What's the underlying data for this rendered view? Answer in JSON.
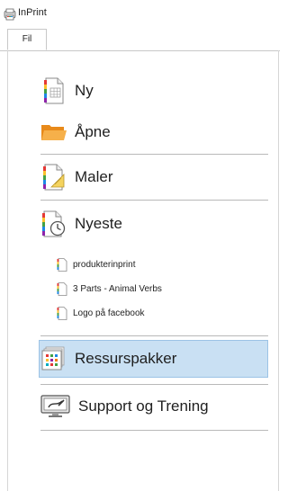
{
  "app": {
    "title": "InPrint"
  },
  "tabs": {
    "file_label": "Fil"
  },
  "menu": {
    "new_label": "Ny",
    "open_label": "Åpne",
    "templates_label": "Maler",
    "recent_label": "Nyeste",
    "resources_label": "Ressurspakker",
    "support_label": "Support og Trening"
  },
  "recent": [
    {
      "label": "produkterinprint"
    },
    {
      "label": "3 Parts - Animal Verbs"
    },
    {
      "label": "Logo på facebook"
    }
  ],
  "colors": {
    "highlight_bg": "#c9e0f3",
    "highlight_border": "#9cc3e5",
    "folder": "#f1a13a"
  },
  "icons": {
    "app": "inprint-logo-icon",
    "new": "new-document-icon",
    "open": "folder-icon",
    "templates": "template-document-icon",
    "recent": "clock-document-icon",
    "resources": "resource-pack-icon",
    "support": "support-monitor-icon",
    "recent_file": "document-file-icon"
  }
}
